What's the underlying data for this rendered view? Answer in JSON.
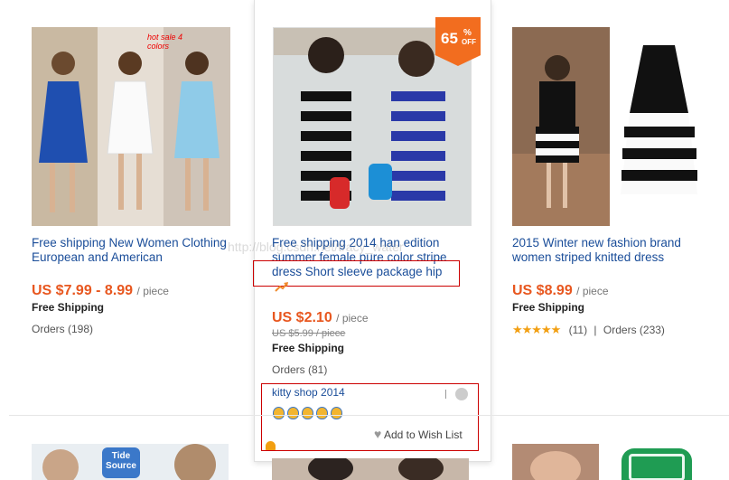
{
  "watermark": "http://blog.csdn.net/tracy_water",
  "products": [
    {
      "title": "Free shipping New Women Clothing European and American",
      "image_tag": "hot sale 4 colors",
      "price": "US $7.99 - 8.99",
      "unit": "/ piece",
      "shipping": "Free Shipping",
      "orders": "Orders (198)"
    },
    {
      "title": "Free shipping 2014 han edition summer female pure color stripe dress Short sleeve package hip",
      "discount_value": "65",
      "discount_unit": "%",
      "discount_off": "OFF",
      "price": "US $2.10",
      "unit": "/ piece",
      "old_price": "US $5.99 / piece",
      "shipping": "Free Shipping",
      "orders": "Orders (81)",
      "shop": "kitty shop 2014",
      "medal_count": 5,
      "wishlist": "Add to Wish List"
    },
    {
      "title": "2015 Winter new fashion brand women striped knitted dress",
      "price": "US $8.99",
      "unit": "/ piece",
      "shipping": "Free Shipping",
      "rating_stars": 5,
      "reviews": "(11)",
      "separator": "|",
      "orders": "Orders (233)"
    }
  ],
  "bottom_logo": "Tide Source",
  "colors": {
    "price": "#e8571f",
    "title": "#1a4d99",
    "discount_badge": "#f26d1f",
    "highlight_box": "#cc0000"
  }
}
